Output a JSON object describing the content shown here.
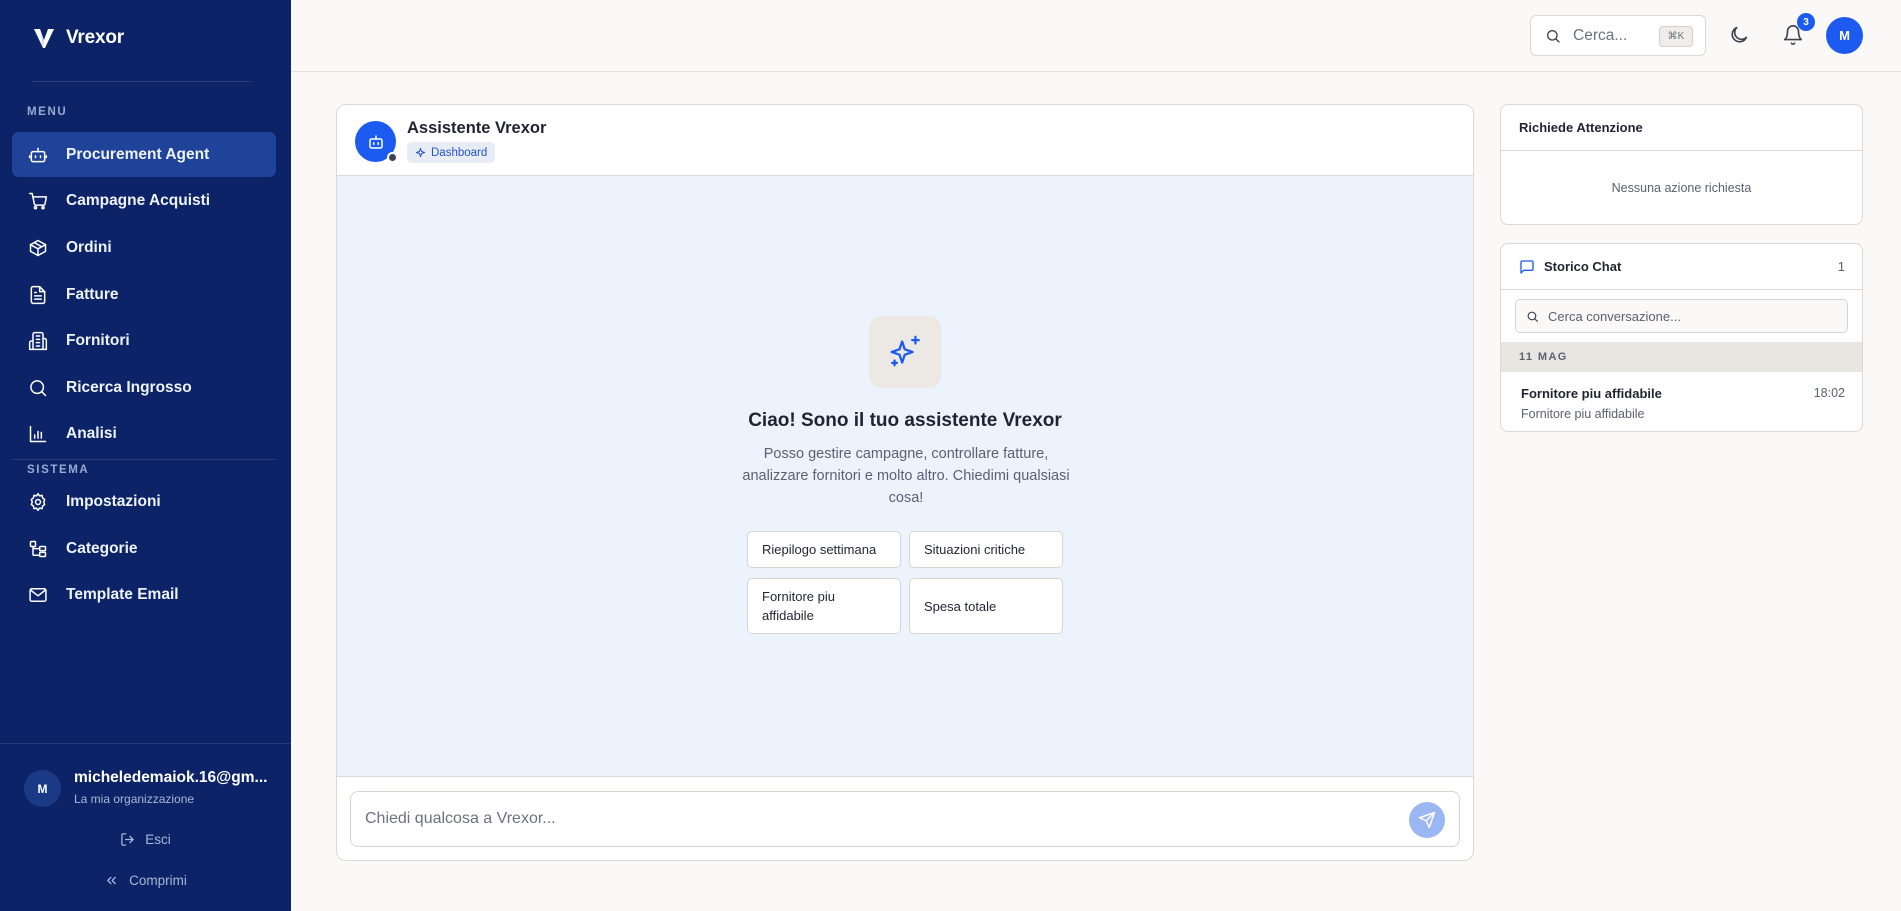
{
  "app": {
    "name": "Vrexor"
  },
  "sidebar": {
    "sections": {
      "menu": "MENU",
      "system": "SISTEMA"
    },
    "menu_items": [
      {
        "label": "Procurement Agent",
        "icon": "robot-icon",
        "active": true
      },
      {
        "label": "Campagne Acquisti",
        "icon": "cart-icon"
      },
      {
        "label": "Ordini",
        "icon": "package-icon"
      },
      {
        "label": "Fatture",
        "icon": "file-icon"
      },
      {
        "label": "Fornitori",
        "icon": "building-icon"
      },
      {
        "label": "Ricerca Ingrosso",
        "icon": "search-icon"
      },
      {
        "label": "Analisi",
        "icon": "bar-chart-icon"
      }
    ],
    "system_items": [
      {
        "label": "Impostazioni",
        "icon": "gear-icon"
      },
      {
        "label": "Categorie",
        "icon": "tree-icon"
      },
      {
        "label": "Template Email",
        "icon": "mail-icon"
      }
    ],
    "user": {
      "initial": "M",
      "email": "micheledemaiok.16@gm...",
      "org": "La mia organizzazione"
    },
    "logout_label": "Esci",
    "collapse_label": "Comprimi"
  },
  "topbar": {
    "search_placeholder": "Cerca...",
    "shortcut": "⌘K",
    "notifications_count": "3",
    "avatar_initial": "M"
  },
  "chat": {
    "title": "Assistente Vrexor",
    "tag": "Dashboard",
    "welcome_title": "Ciao! Sono il tuo assistente Vrexor",
    "welcome_text": "Posso gestire campagne, controllare fatture, analizzare fornitori e molto altro. Chiedimi qualsiasi cosa!",
    "suggestions": [
      "Riepilogo settimana",
      "Situazioni critiche",
      "Fornitore piu affidabile",
      "Spesa totale"
    ],
    "input_placeholder": "Chiedi qualcosa a Vrexor..."
  },
  "attention": {
    "title": "Richiede Attenzione",
    "empty": "Nessuna azione richiesta"
  },
  "history": {
    "title": "Storico Chat",
    "count": "1",
    "search_placeholder": "Cerca conversazione...",
    "date_group": "11 MAG",
    "items": [
      {
        "title": "Fornitore piu affidabile",
        "time": "18:02",
        "subtitle": "Fornitore piu affidabile"
      }
    ]
  },
  "colors": {
    "sidebar": "#0c2467",
    "accent": "#1d5bf0",
    "chat_bg": "#edf3fd"
  }
}
